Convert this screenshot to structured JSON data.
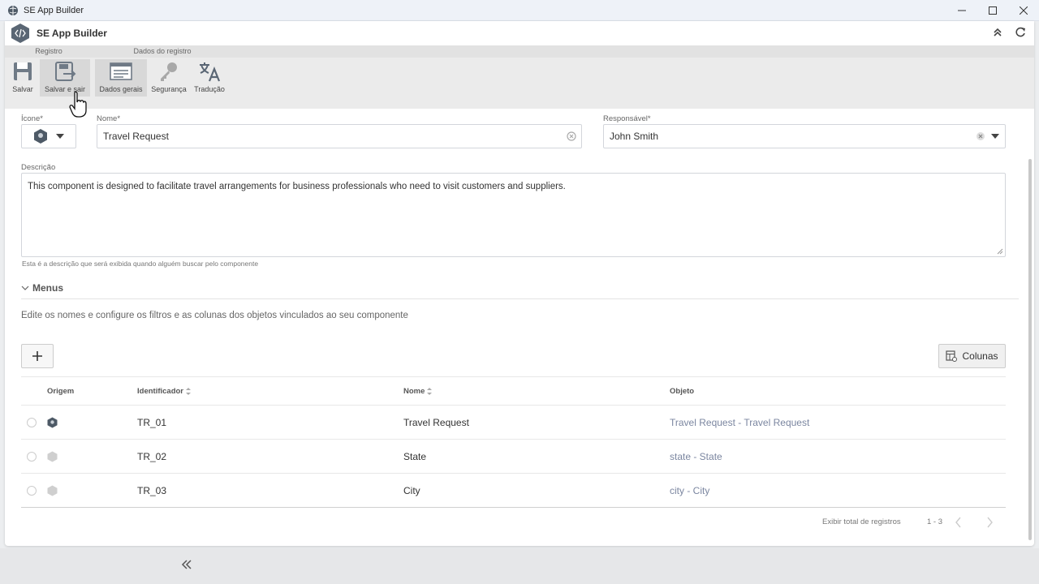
{
  "window": {
    "title": "SE App Builder"
  },
  "header": {
    "title": "SE App Builder"
  },
  "ribbon": {
    "groups": [
      {
        "label": "Registro",
        "buttons": [
          "Salvar",
          "Salvar e sair"
        ]
      },
      {
        "label": "Dados do registro",
        "buttons": [
          "Dados gerais",
          "Segurança",
          "Tradução"
        ]
      }
    ]
  },
  "form": {
    "icon_label": "Ícone",
    "name_label": "Nome",
    "name_value": "Travel Request",
    "responsible_label": "Responsável",
    "responsible_value": "John Smith",
    "description_label": "Descrição",
    "description_value": "This component is designed to facilitate travel arrangements for business professionals who need to visit customers and suppliers.",
    "description_helper": "Esta é a descrição que será exibida quando alguém buscar pelo componente",
    "required_mark": "*"
  },
  "menus": {
    "title": "Menus",
    "description": "Edite os nomes e configure os filtros e as colunas dos objetos vinculados ao seu componente",
    "add_button": "+",
    "columns_button": "Colunas",
    "table": {
      "headers": [
        "Origem",
        "Identificador",
        "Nome",
        "Objeto"
      ],
      "rows": [
        {
          "id": "TR_01",
          "name": "Travel Request",
          "object": "Travel Request - Travel Request"
        },
        {
          "id": "TR_02",
          "name": "State",
          "object": "state - State"
        },
        {
          "id": "TR_03",
          "name": "City",
          "object": "city - City"
        }
      ]
    },
    "footer": {
      "total_label": "Exibir total de registros",
      "range": "1 - 3"
    }
  },
  "colors": {
    "accent": "#5a6a7d",
    "object_link": "#7b86a0",
    "ribbon_bg": "#ebebeb"
  }
}
